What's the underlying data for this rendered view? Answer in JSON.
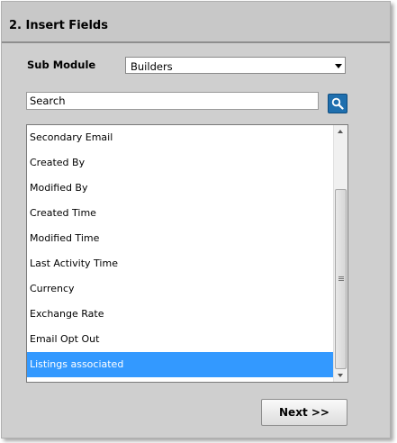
{
  "header": {
    "title": "2. Insert Fields"
  },
  "sub_module": {
    "label": "Sub Module",
    "selected": "Builders"
  },
  "search": {
    "placeholder": "Search",
    "value": ""
  },
  "fields": {
    "items": [
      {
        "label": "Secondary Email",
        "selected": false
      },
      {
        "label": "Created By",
        "selected": false
      },
      {
        "label": "Modified By",
        "selected": false
      },
      {
        "label": "Created Time",
        "selected": false
      },
      {
        "label": "Modified Time",
        "selected": false
      },
      {
        "label": "Last Activity Time",
        "selected": false
      },
      {
        "label": "Currency",
        "selected": false
      },
      {
        "label": "Exchange Rate",
        "selected": false
      },
      {
        "label": "Email Opt Out",
        "selected": false
      },
      {
        "label": "Listings associated",
        "selected": true
      }
    ]
  },
  "actions": {
    "next_label": "Next >>"
  },
  "icons": {
    "search_button": "search-icon",
    "dropdown": "chevron-down-icon"
  },
  "colors": {
    "selection": "#3399ff",
    "search_button": "#1f6fae",
    "panel": "#cfcfcf"
  }
}
